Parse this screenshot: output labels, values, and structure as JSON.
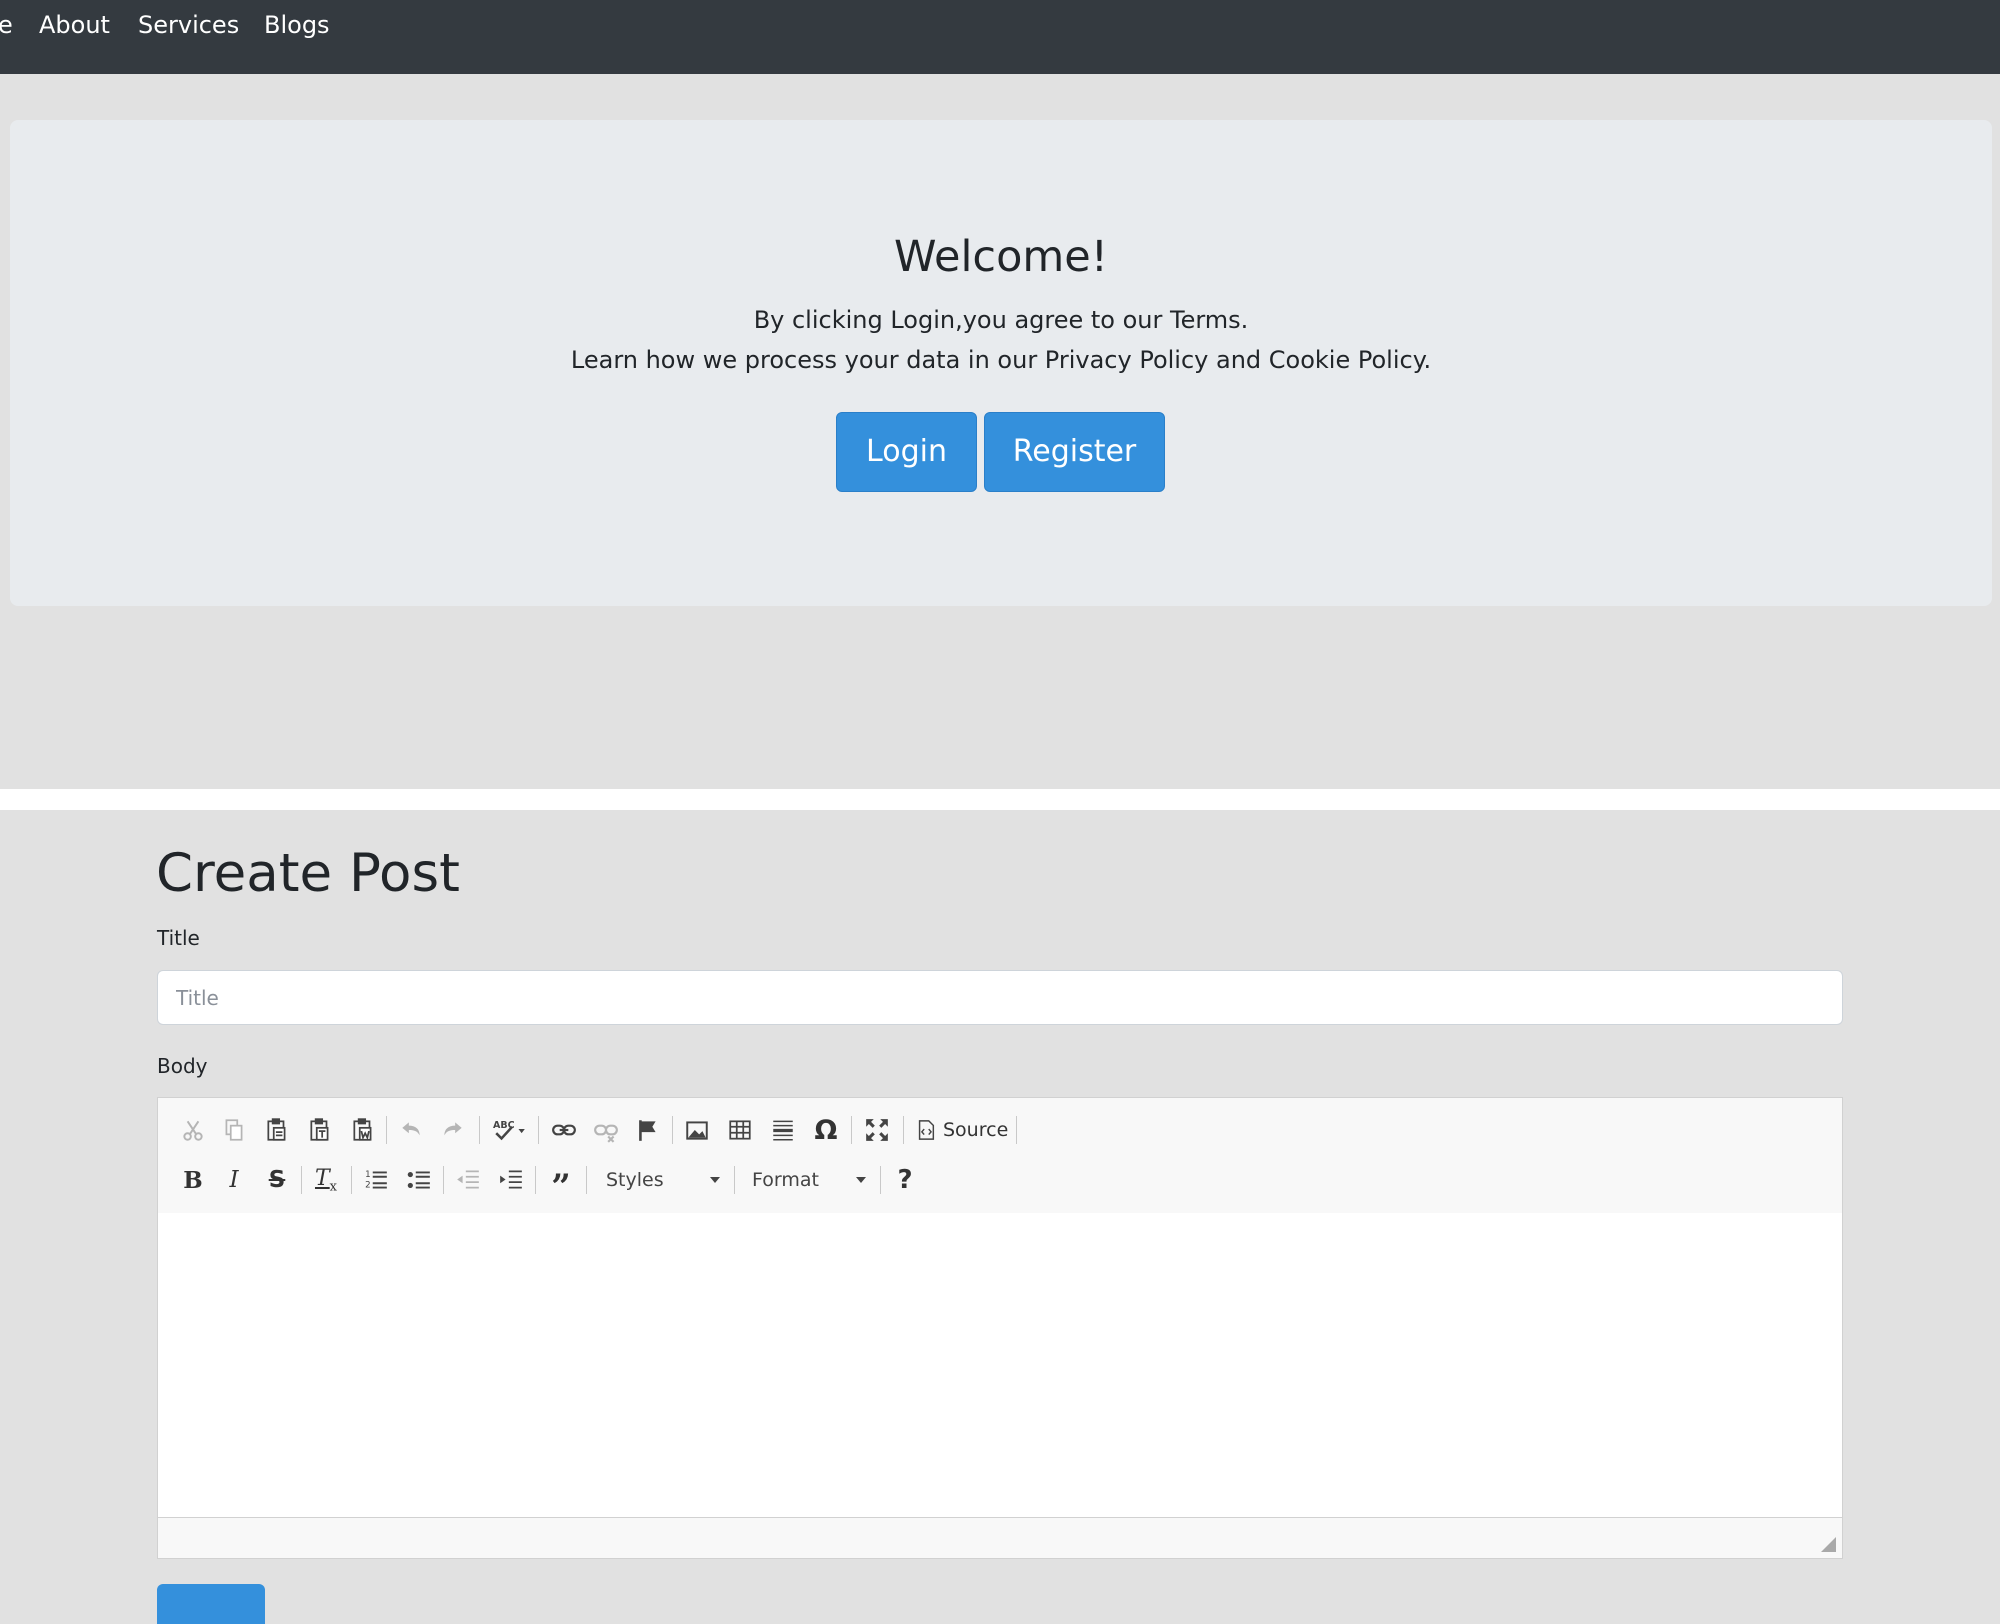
{
  "navbar": {
    "items": [
      {
        "label": "e"
      },
      {
        "label": "About"
      },
      {
        "label": "Services"
      },
      {
        "label": "Blogs"
      }
    ]
  },
  "welcome": {
    "heading": "Welcome!",
    "line1": "By clicking Login,you agree to our Terms.",
    "line2": "Learn how we process your data in our Privacy Policy and Cookie Policy.",
    "login_label": "Login",
    "register_label": "Register"
  },
  "create_post": {
    "heading": "Create Post",
    "title_label": "Title",
    "title_placeholder": "Title",
    "title_value": "",
    "body_label": "Body"
  },
  "editor": {
    "source_label": "Source",
    "styles_label": "Styles",
    "format_label": "Format",
    "help_label": "?",
    "toolbar_row1_icons": [
      "cut-icon",
      "copy-icon",
      "paste-icon",
      "paste-text-icon",
      "paste-word-icon",
      "undo-icon",
      "redo-icon",
      "spellcheck-icon",
      "link-icon",
      "unlink-icon",
      "anchor-icon",
      "image-icon",
      "table-icon",
      "horizontal-rule-icon",
      "special-char-icon",
      "maximize-icon",
      "source-icon"
    ],
    "toolbar_row2_icons": [
      "bold-icon",
      "italic-icon",
      "strikethrough-icon",
      "remove-format-icon",
      "numbered-list-icon",
      "bulleted-list-icon",
      "outdent-icon",
      "indent-icon",
      "blockquote-icon"
    ]
  },
  "colors": {
    "navbar_bg": "#343a40",
    "primary": "#3490dc",
    "page_bg": "#e1e1e1",
    "jumbotron_bg": "#e8ebee"
  }
}
